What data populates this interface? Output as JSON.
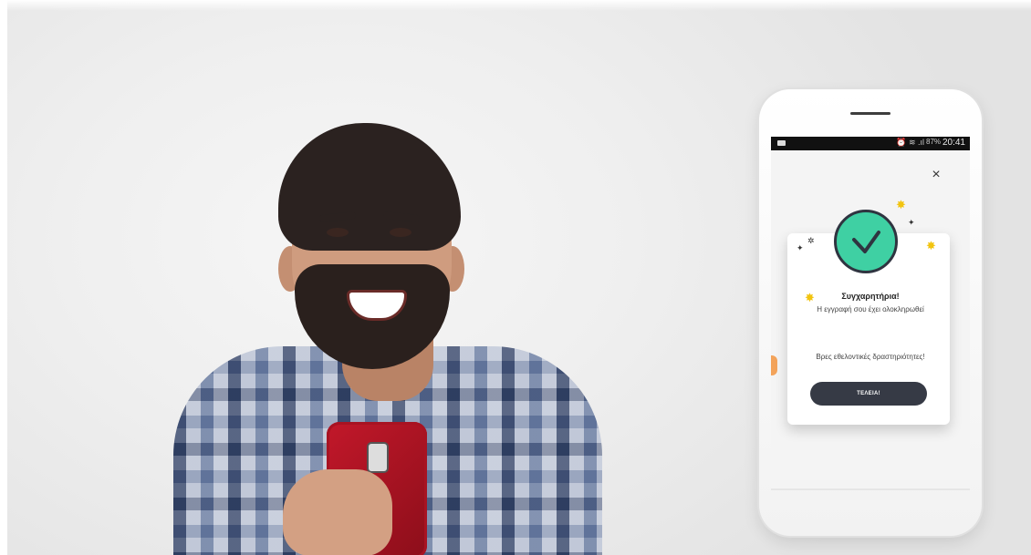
{
  "status_bar": {
    "icons": "⏰ ≋ .ıl",
    "battery": "87%",
    "time": "20:41"
  },
  "dialog": {
    "close_label": "×",
    "title": "Συγχαρητήρια!",
    "subtitle": "Η εγγραφή σου έχει ολοκληρωθεί",
    "link_text": "Βρες εθελοντικές δραστηριότητες!",
    "done_button": "ΤΕΛΕΙΑ!"
  },
  "colors": {
    "check_fill": "#3fd0a3",
    "button_bg": "#363a45",
    "sparkle": "#f2c40f"
  },
  "icons": {
    "success": "check-circle-icon",
    "close": "close-icon"
  }
}
